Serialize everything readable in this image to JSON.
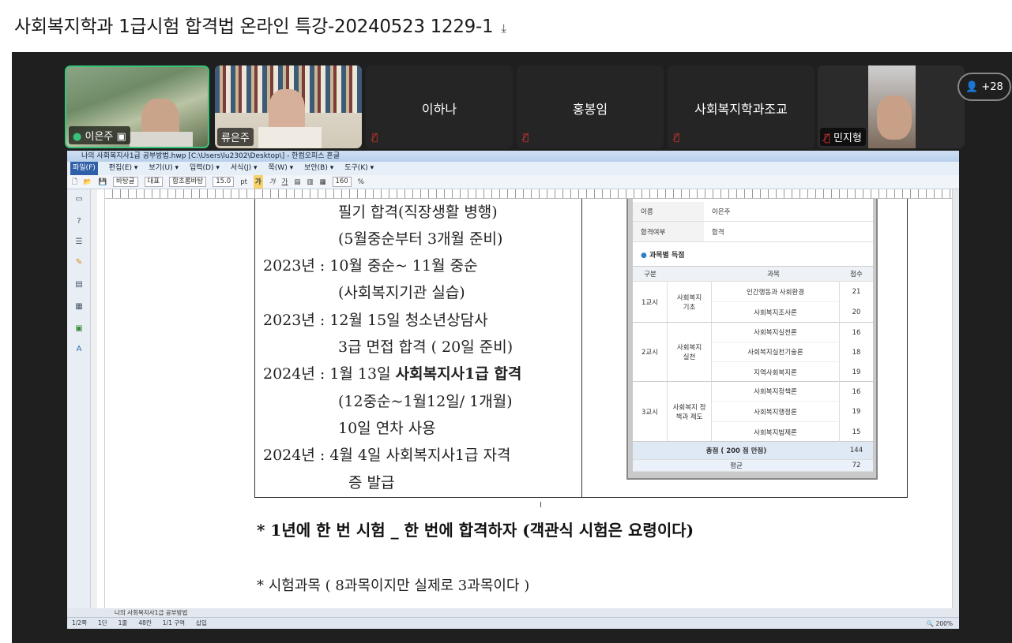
{
  "window": {
    "title": "사회복지학과 1급시험 합격법 온라인 특강-20240523 1229-1"
  },
  "participants": {
    "video": [
      {
        "name": "이은주"
      },
      {
        "name": "류은주"
      }
    ],
    "names_only": [
      {
        "name": "이하나"
      },
      {
        "name": "홍봉임"
      },
      {
        "name": "사회복지학과조교"
      }
    ],
    "last": {
      "name": "민지형"
    },
    "more_count": "+28"
  },
  "hwp": {
    "title_bar": "나의 사회복지사1급 공부방법.hwp [C:\\Users\\lu2302\\Desktop\\] - 한컴오피스 흔글",
    "menu": [
      "파일(F)",
      "편집(E) ▾",
      "보기(U) ▾",
      "입력(D) ▾",
      "서식(J) ▾",
      "쪽(W) ▾",
      "보안(B) ▾",
      "도구(K) ▾"
    ],
    "toolbar": {
      "style": "바탕글",
      "lang": "대표",
      "font": "함초롬바탕",
      "size": "15.0",
      "unit": "pt",
      "zoom": "160",
      "zoom_unit": "%"
    },
    "sheet_tab": "나의 사회복지사1급 공부방법",
    "status": [
      "1/2쪽",
      "1단",
      "1줄",
      "48칸",
      "1/1 구역",
      "삽입"
    ],
    "zoom_status": "200%"
  },
  "document": {
    "lines": [
      "필기 합격(직장생활 병행)",
      "(5월중순부터 3개월 준비)",
      "2023년 : 10월 중순~ 11월 중순",
      "(사회복지기관 실습)",
      "2023년 : 12월 15일 청소년상담사",
      "3급 면접 합격 ( 20일 준비)",
      "2024년 : 1월 13일 ",
      "사회복지사1급 합격",
      "(12중순~1월12일/ 1개월)",
      "10일 연차 사용",
      "2024년 : 4월 4일 사회복지사1급 자격",
      "증 발급"
    ],
    "heading": "* 1년에 한 번 시험 _ 한 번에 합격하자 (객관식 시험은 요령이다)",
    "subline": "* 시험과목 ( 8과목이지만 실제로 3과목이다 )"
  },
  "score_card": {
    "name_label": "이름",
    "name_value": "이은주",
    "pass_label": "합격여부",
    "pass_value": "합격",
    "section_title": "과목별 득점",
    "headers": [
      "구분",
      "과목",
      "점수"
    ],
    "groups": [
      {
        "session": "1교시",
        "area": "사회복지 기초",
        "subjects": [
          {
            "name": "인간행동과 사회환경",
            "score": "21"
          },
          {
            "name": "사회복지조사론",
            "score": "20"
          }
        ]
      },
      {
        "session": "2교시",
        "area": "사회복지 실천",
        "subjects": [
          {
            "name": "사회복지실천론",
            "score": "16"
          },
          {
            "name": "사회복지실천기술론",
            "score": "18"
          },
          {
            "name": "지역사회복지론",
            "score": "19"
          }
        ]
      },
      {
        "session": "3교시",
        "area": "사회복지 정책과 제도",
        "subjects": [
          {
            "name": "사회복지정책론",
            "score": "16"
          },
          {
            "name": "사회복지행정론",
            "score": "19"
          },
          {
            "name": "사회복지법제론",
            "score": "15"
          }
        ]
      }
    ],
    "total_label": "총점 ( 200 점 만점)",
    "total_value": "144",
    "avg_label": "평균",
    "avg_value": "72"
  }
}
